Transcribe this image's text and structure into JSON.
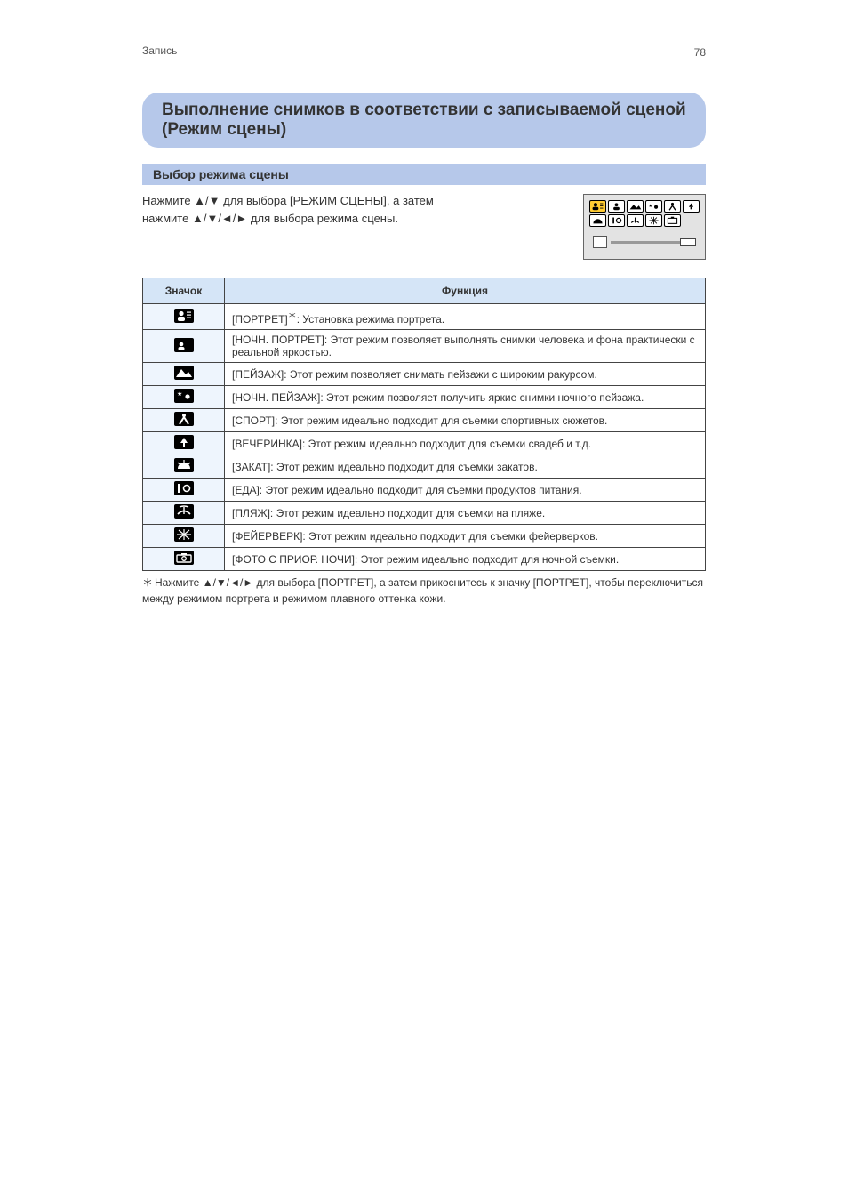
{
  "header": {
    "breadcrumb": "Запись",
    "page_number": "78"
  },
  "title": "Выполнение снимков в соответствии с записываемой сценой (Режим сцены)",
  "subtitle": "Выбор режима сцены",
  "intro": {
    "line1_pre": "Нажмите ",
    "line1_arrows": "▲/▼",
    "line1_post": " для выбора [РЕЖИМ СЦЕНЫ], а затем",
    "line2_pre": "нажмите ",
    "line2_arrows": "▲/▼/◄/►",
    "line2_post": " для выбора режима сцены."
  },
  "table": {
    "head_icon": "Значок",
    "head_desc": "Функция",
    "rows": [
      {
        "desc_pre": "[ПОРТРЕТ]",
        "desc_ast": "＊",
        "desc_post": ": Установка режима портрета."
      },
      {
        "desc": "[НОЧН. ПОРТРЕТ]: Этот режим позволяет выполнять снимки человека и фона практически с реальной яркостью."
      },
      {
        "desc": "[ПЕЙЗАЖ]: Этот режим позволяет снимать пейзажи с широким ракурсом."
      },
      {
        "desc": "[НОЧН. ПЕЙЗАЖ]: Этот режим позволяет получить яркие снимки ночного пейзажа."
      },
      {
        "desc": "[СПОРТ]: Этот режим идеально подходит для съемки спортивных сюжетов."
      },
      {
        "desc": "[ВЕЧЕРИНКА]: Этот режим идеально подходит для съемки свадеб и т.д."
      },
      {
        "desc": "[ЗАКАТ]: Этот режим идеально подходит для съемки закатов."
      },
      {
        "desc": "[ЕДА]: Этот режим идеально подходит для съемки продуктов питания."
      },
      {
        "desc": "[ПЛЯЖ]: Этот режим идеально подходит для съемки на пляже."
      },
      {
        "desc": "[ФЕЙЕРВЕРК]: Этот режим идеально подходит для съемки фейерверков."
      },
      {
        "desc": "[ФОТО С ПРИОР. НОЧИ]: Этот режим идеально подходит для ночной съемки."
      }
    ]
  },
  "footnote": {
    "ast": "＊",
    "pre": "Нажмите ",
    "arrows": "▲/▼/◄/►",
    "post": " для выбора [ПОРТРЕТ], а затем прикоснитесь к значку [ПОРТРЕТ], чтобы переключиться между режимом портрета и режимом плавного оттенка кожи."
  }
}
